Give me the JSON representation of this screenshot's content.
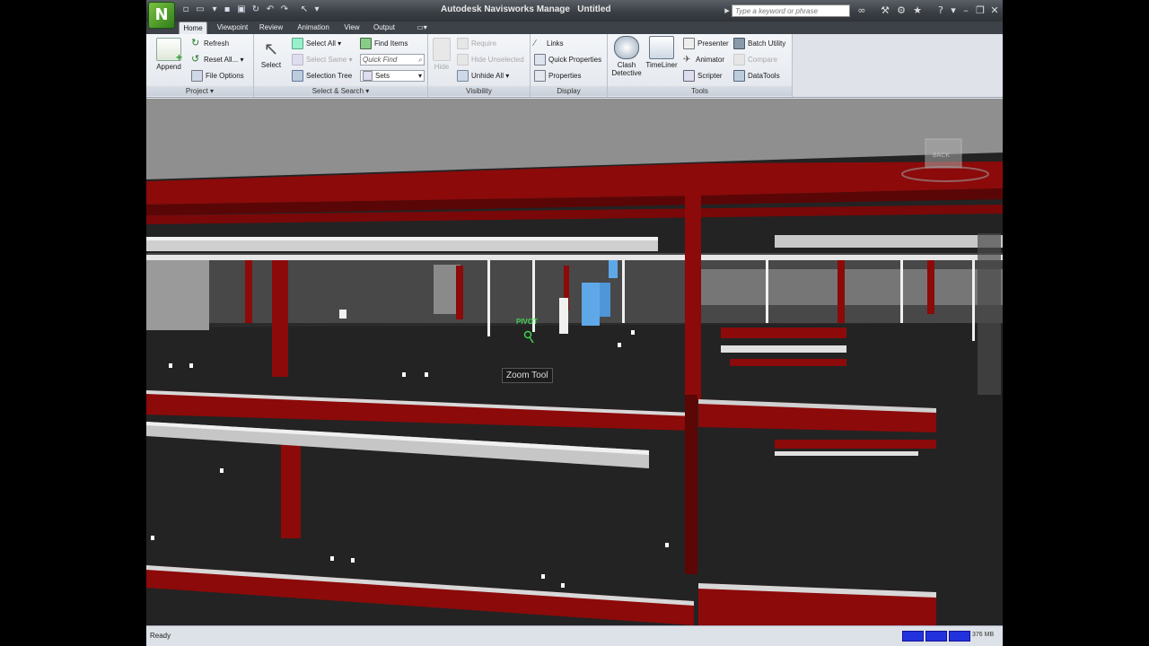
{
  "app": {
    "title": "Autodesk Navisworks Manage",
    "document": "Untitled",
    "logo_letter": "N"
  },
  "search": {
    "placeholder": "Type a keyword or phrase"
  },
  "tabs": [
    "Home",
    "Viewpoint",
    "Review",
    "Animation",
    "View",
    "Output"
  ],
  "ribbon": {
    "project": {
      "title": "Project",
      "append": "Append",
      "refresh": "Refresh",
      "reset_all": "Reset All...",
      "file_options": "File Options"
    },
    "select_search": {
      "title": "Select & Search",
      "select": "Select",
      "select_all": "Select All",
      "select_same": "Select Same",
      "selection_tree": "Selection Tree",
      "find_items": "Find Items",
      "quick_find": "Quick Find",
      "sets": "Sets"
    },
    "visibility": {
      "title": "Visibility",
      "hide": "Hide",
      "require": "Require",
      "hide_unselected": "Hide Unselected",
      "unhide_all": "Unhide All"
    },
    "display": {
      "title": "Display",
      "links": "Links",
      "quick_properties": "Quick Properties",
      "properties": "Properties"
    },
    "tools": {
      "title": "Tools",
      "clash_detective_1": "Clash",
      "clash_detective_2": "Detective",
      "timeliner": "TimeLiner",
      "presenter": "Presenter",
      "animator": "Animator",
      "scripter": "Scripter",
      "batch_utility": "Batch Utility",
      "compare": "Compare",
      "datatools": "DataTools"
    }
  },
  "viewport": {
    "pivot": "PIVOT",
    "tooltip": "Zoom Tool",
    "viewcube": "BACK"
  },
  "status": {
    "text": "Ready",
    "memory": "376 MB"
  },
  "colors": {
    "steel": "#8c0a0a",
    "pipe": "#d8d8d8",
    "floor": "#232323",
    "ceiling": "#8f8f8f"
  }
}
